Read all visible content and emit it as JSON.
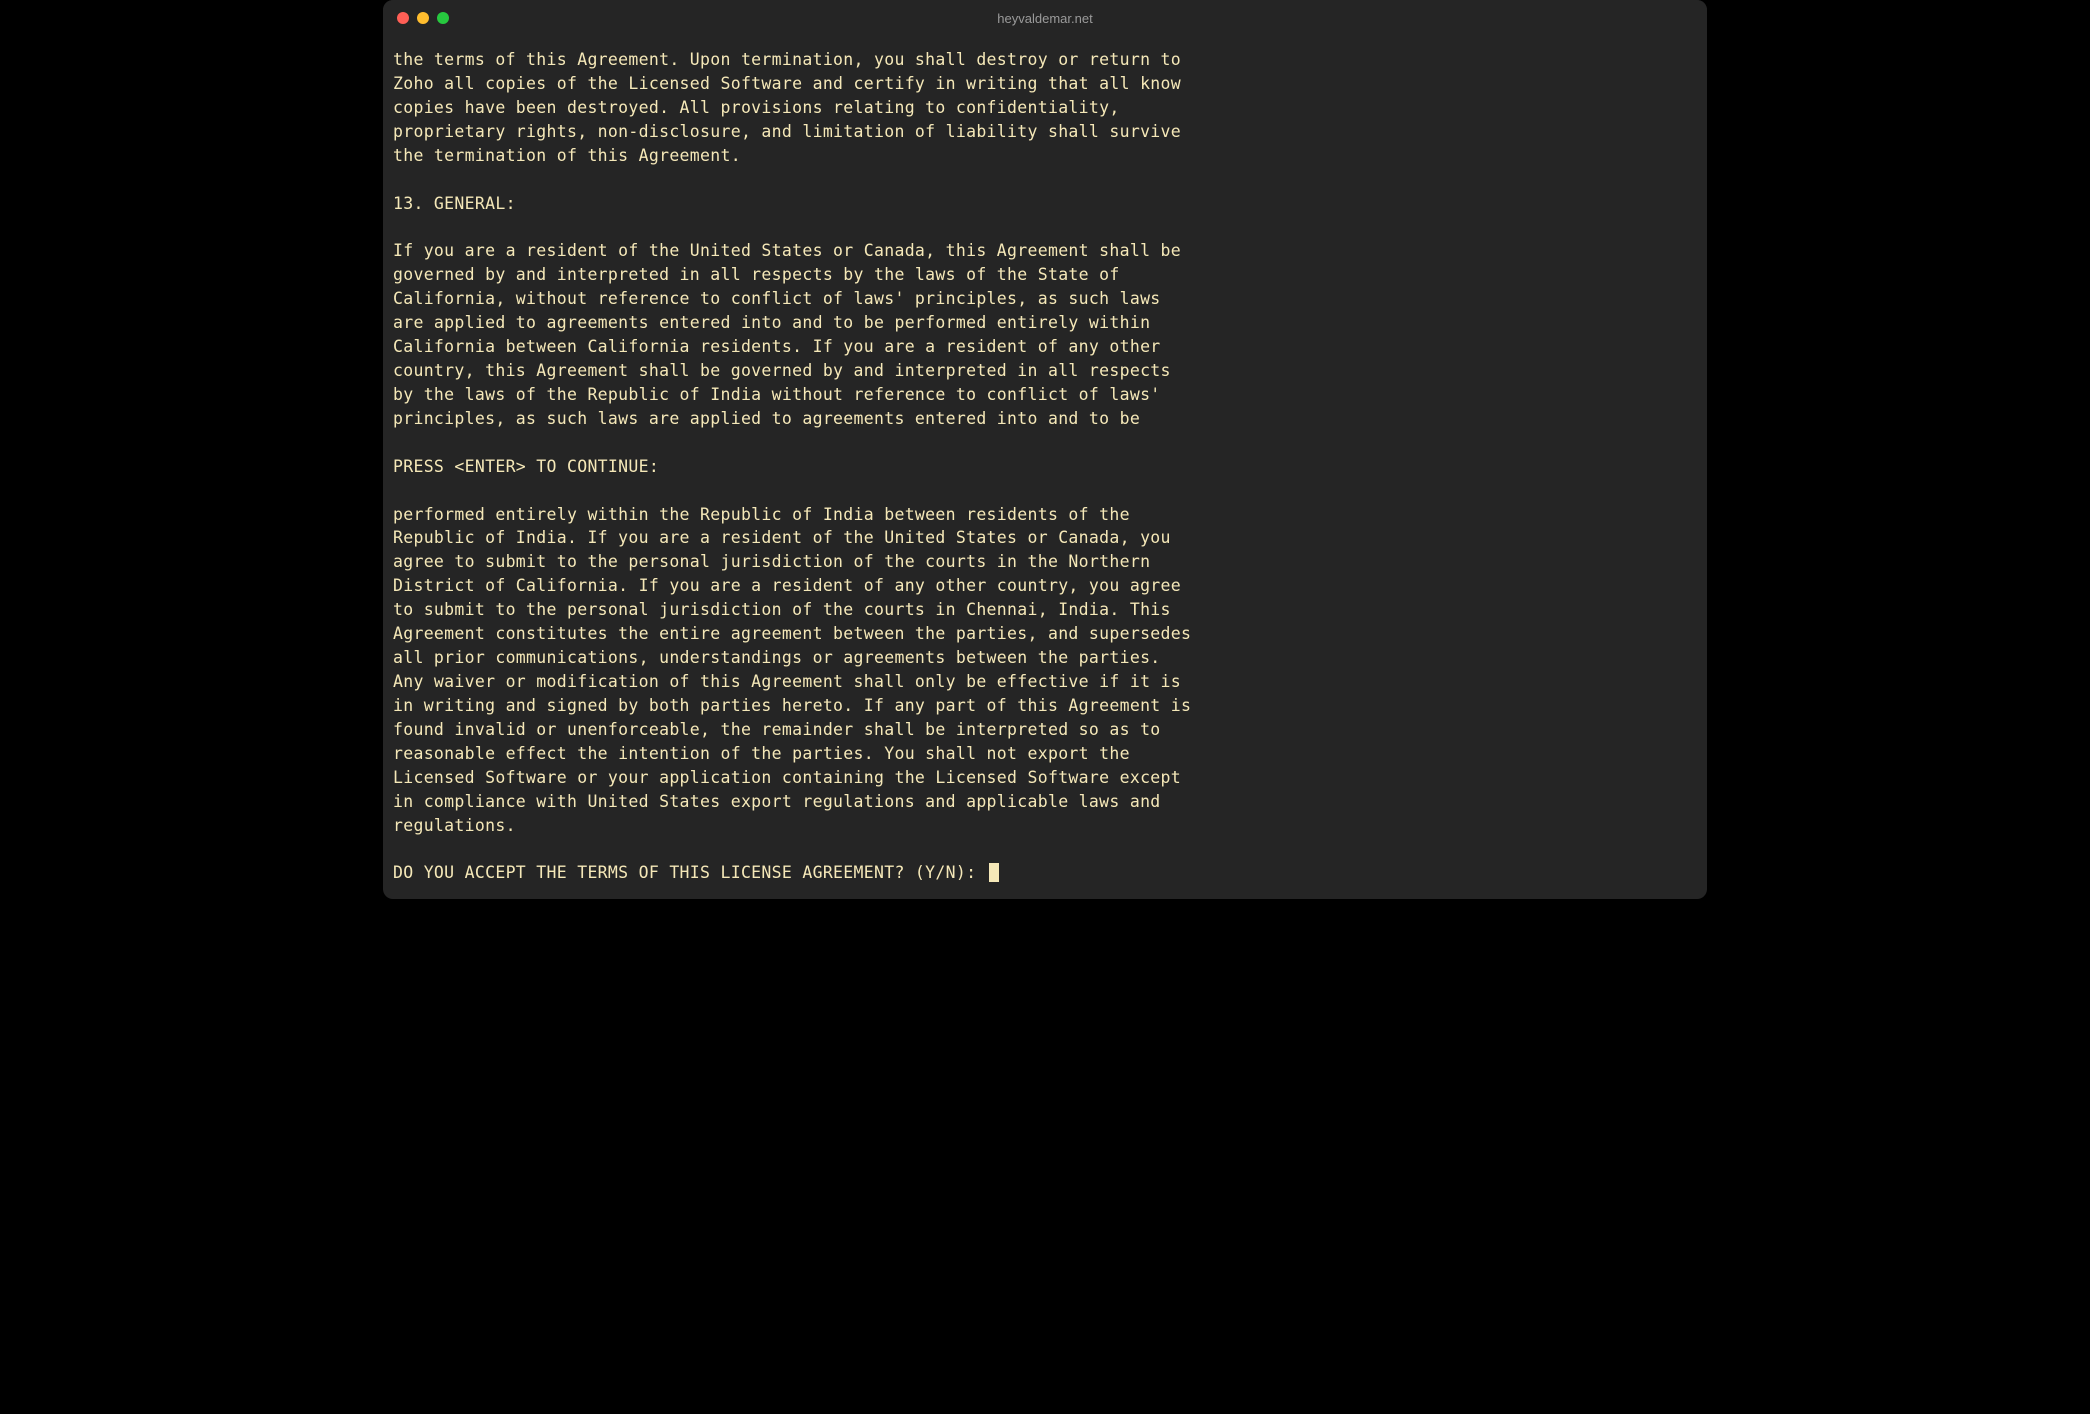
{
  "window": {
    "title": "heyvaldemar.net"
  },
  "terminal": {
    "lines": [
      "the terms of this Agreement. Upon termination, you shall destroy or return to",
      "Zoho all copies of the Licensed Software and certify in writing that all know",
      "copies have been destroyed. All provisions relating to confidentiality,",
      "proprietary rights, non-disclosure, and limitation of liability shall survive",
      "the termination of this Agreement.",
      "",
      "13. GENERAL:",
      "",
      "If you are a resident of the United States or Canada, this Agreement shall be",
      "governed by and interpreted in all respects by the laws of the State of",
      "California, without reference to conflict of laws' principles, as such laws",
      "are applied to agreements entered into and to be performed entirely within",
      "California between California residents. If you are a resident of any other",
      "country, this Agreement shall be governed by and interpreted in all respects",
      "by the laws of the Republic of India without reference to conflict of laws'",
      "principles, as such laws are applied to agreements entered into and to be",
      "",
      "PRESS <ENTER> TO CONTINUE:",
      "",
      "performed entirely within the Republic of India between residents of the",
      "Republic of India. If you are a resident of the United States or Canada, you",
      "agree to submit to the personal jurisdiction of the courts in the Northern",
      "District of California. If you are a resident of any other country, you agree",
      "to submit to the personal jurisdiction of the courts in Chennai, India. This",
      "Agreement constitutes the entire agreement between the parties, and supersedes",
      "all prior communications, understandings or agreements between the parties.",
      "Any waiver or modification of this Agreement shall only be effective if it is",
      "in writing and signed by both parties hereto. If any part of this Agreement is",
      "found invalid or unenforceable, the remainder shall be interpreted so as to",
      "reasonable effect the intention of the parties. You shall not export the",
      "Licensed Software or your application containing the Licensed Software except",
      "in compliance with United States export regulations and applicable laws and",
      "regulations.",
      ""
    ],
    "prompt": "DO YOU ACCEPT THE TERMS OF THIS LICENSE AGREEMENT? (Y/N): "
  }
}
